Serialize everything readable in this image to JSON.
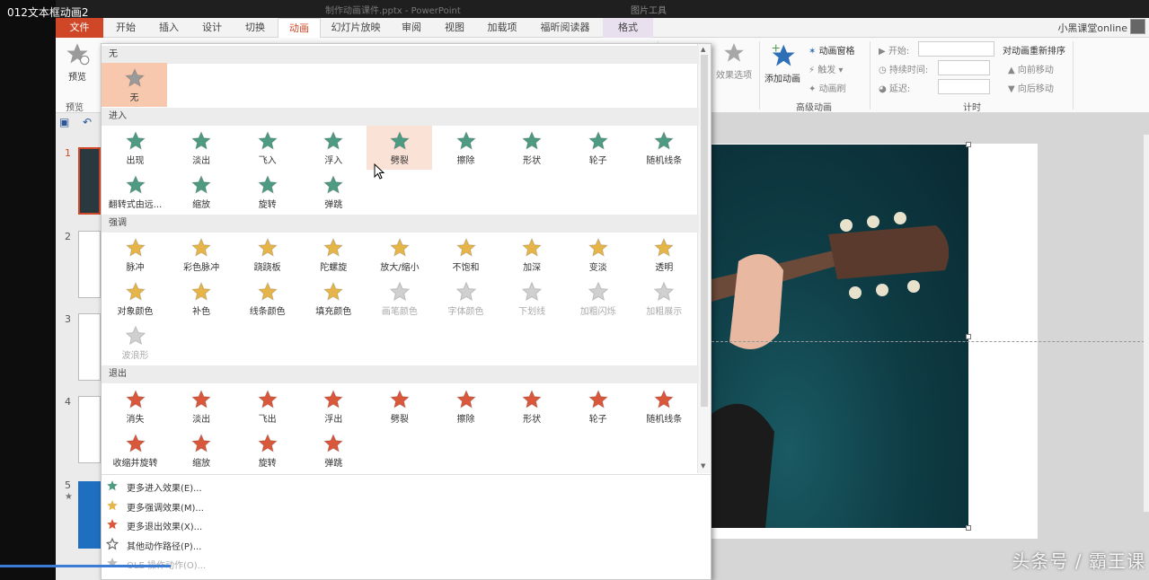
{
  "video_title": "012文本框动画2",
  "titlebar": {
    "center": "制作动画课件.pptx - PowerPoint",
    "right": "图片工具"
  },
  "tabs": [
    "文件",
    "开始",
    "插入",
    "设计",
    "切换",
    "动画",
    "幻灯片放映",
    "审阅",
    "视图",
    "加载项",
    "福昕阅读器",
    "格式"
  ],
  "active_tab": "动画",
  "user_name": "小黑课堂online",
  "ribbon": {
    "preview_label": "预览",
    "preview_group": "预览",
    "effect_options": "效果选项",
    "add_animation": "添加动画",
    "animation_pane": "动画窗格",
    "trigger": "触发",
    "animation_painter": "动画刷",
    "advanced_group": "高级动画",
    "start_label": "开始:",
    "duration_label": "持续时间:",
    "delay_label": "延迟:",
    "timing_group": "计时",
    "reorder_title": "对动画重新排序",
    "move_earlier": "向前移动",
    "move_later": "向后移动"
  },
  "slides": [
    "1",
    "2",
    "3",
    "4",
    "5"
  ],
  "gallery": {
    "sections": {
      "none": "无",
      "entrance": "进入",
      "emphasis": "强调",
      "exit": "退出"
    },
    "none_effect": "无",
    "entrance": [
      "出现",
      "淡出",
      "飞入",
      "浮入",
      "劈裂",
      "擦除",
      "形状",
      "轮子",
      "随机线条",
      "翻转式由远...",
      "缩放",
      "旋转",
      "弹跳"
    ],
    "emphasis": [
      "脉冲",
      "彩色脉冲",
      "跷跷板",
      "陀螺旋",
      "放大/缩小",
      "不饱和",
      "加深",
      "变淡",
      "透明",
      "对象颜色",
      "补色",
      "线条颜色",
      "填充颜色",
      "画笔颜色",
      "字体颜色",
      "下划线",
      "加粗闪烁",
      "加粗展示",
      "波浪形"
    ],
    "emphasis_disabled_from": 13,
    "exit": [
      "消失",
      "淡出",
      "飞出",
      "浮出",
      "劈裂",
      "擦除",
      "形状",
      "轮子",
      "随机线条",
      "收缩并旋转",
      "缩放",
      "旋转",
      "弹跳"
    ],
    "hovered_entrance": "劈裂",
    "more": [
      {
        "label": "更多进入效果(E)...",
        "icon": "green-star-icon"
      },
      {
        "label": "更多强调效果(M)...",
        "icon": "gold-star-icon"
      },
      {
        "label": "更多退出效果(X)...",
        "icon": "red-star-icon"
      },
      {
        "label": "其他动作路径(P)...",
        "icon": "outline-star-icon"
      },
      {
        "label": "OLE 操作动作(O)...",
        "icon": "gear-icon"
      }
    ]
  },
  "colors": {
    "entrance": "#4e9a83",
    "emphasis": "#e6b54a",
    "exit": "#d9573b",
    "accent": "#d04727"
  },
  "watermark": "头条号 / 霸王课"
}
